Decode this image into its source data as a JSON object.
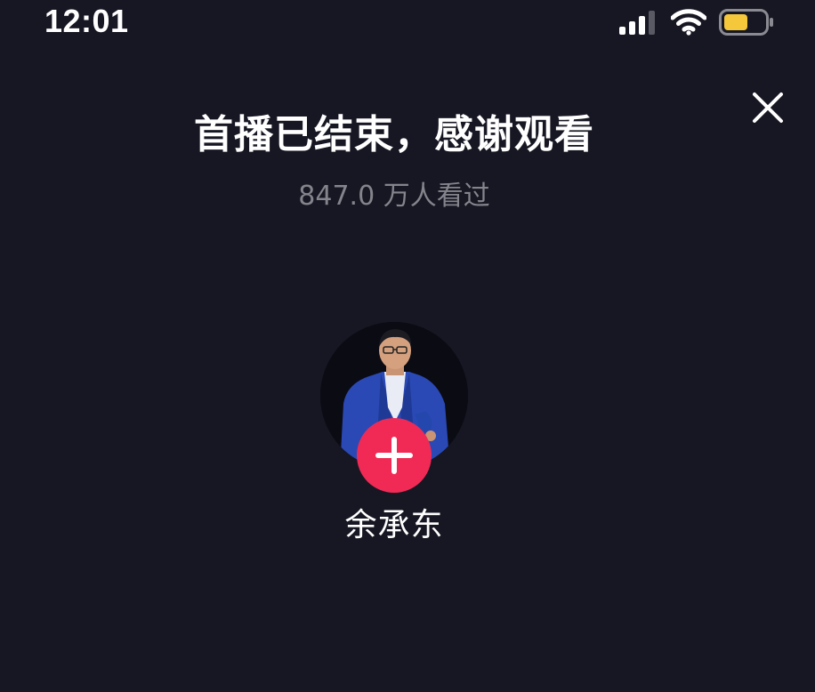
{
  "status_bar": {
    "time": "12:01",
    "icons": [
      "cellular-signal-icon",
      "wifi-icon",
      "battery-icon"
    ],
    "battery_color": "#f5c73a"
  },
  "live_end": {
    "title": "首播已结束，感谢观看",
    "viewers": "847.0 万人看过",
    "close_icon": "close-icon"
  },
  "streamer": {
    "name": "余承东",
    "follow_icon": "plus-icon"
  },
  "colors": {
    "background": "#171723",
    "accent": "#f02a55",
    "secondary_text": "#84848c"
  }
}
